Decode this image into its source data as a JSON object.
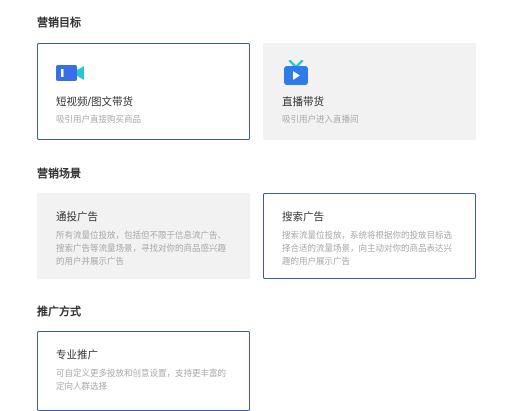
{
  "goal": {
    "title": "营销目标",
    "options": [
      {
        "title": "短视频/图文带货",
        "desc": "吸引用户直接购买商品",
        "icon": "video-camera-icon",
        "selected": true
      },
      {
        "title": "直播带货",
        "desc": "吸引用户进入直播间",
        "icon": "live-tv-icon",
        "selected": false
      }
    ]
  },
  "scene": {
    "title": "营销场景",
    "options": [
      {
        "title": "通投广告",
        "desc": "所有流量位投放，包括但不限于信息流广告、搜索广告等流量场景，寻找对你的商品感兴趣的用户并展示广告",
        "selected": false
      },
      {
        "title": "搜索广告",
        "desc": "搜索流量位投放，系统将根据你的投放目标选择合适的流量场景，向主动对你的商品表达兴趣的用户展示广告",
        "selected": true
      }
    ]
  },
  "method": {
    "title": "推广方式",
    "options": [
      {
        "title": "专业推广",
        "desc": "可自定义更多投放和创意设置，支持更丰富的定向人群选择",
        "selected": true
      }
    ]
  },
  "colors": {
    "accent": "#3c5aa8",
    "video_icon": "#3a6ee8",
    "live_icon": "#2f7be8",
    "live_antenna": "#29c7d6"
  }
}
